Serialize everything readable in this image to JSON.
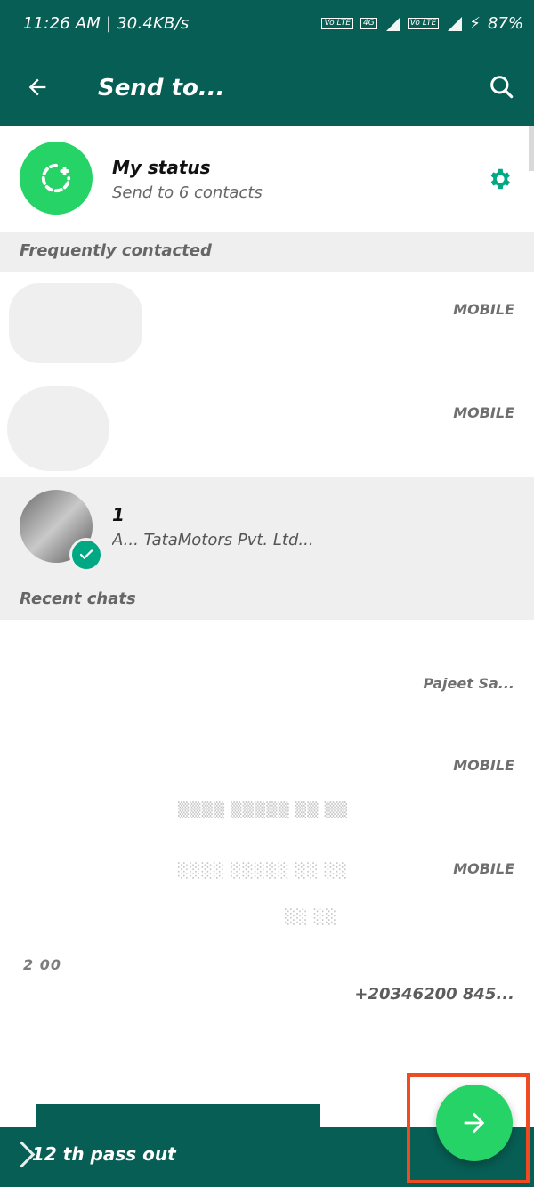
{
  "status_bar": {
    "time": "11:26 AM | 30.4KB/s",
    "battery": "87%",
    "net_tag_1": "Vo LTE",
    "net_tag_2": "4G",
    "net_tag_3": "Vo LTE"
  },
  "app_bar": {
    "title": "Send to..."
  },
  "my_status": {
    "title": "My status",
    "subtitle": "Send to 6 contacts"
  },
  "sections": {
    "frequent": "Frequently contacted",
    "recent": "Recent chats"
  },
  "contacts": [
    {
      "label": "MOBILE"
    },
    {
      "label": "MOBILE"
    },
    {
      "name": "1",
      "subtitle": "A... TataMotors Pvt. Ltd..."
    },
    {
      "right": "Pajeet Sa..."
    },
    {
      "label": "MOBILE"
    },
    {
      "label": "MOBILE"
    },
    {
      "left": "2 00",
      "right": "+20346200 845..."
    }
  ],
  "bottom": {
    "text": "12 th pass out"
  },
  "colors": {
    "primary": "#075e54",
    "accent": "#25d366",
    "highlight": "#f04a22"
  }
}
